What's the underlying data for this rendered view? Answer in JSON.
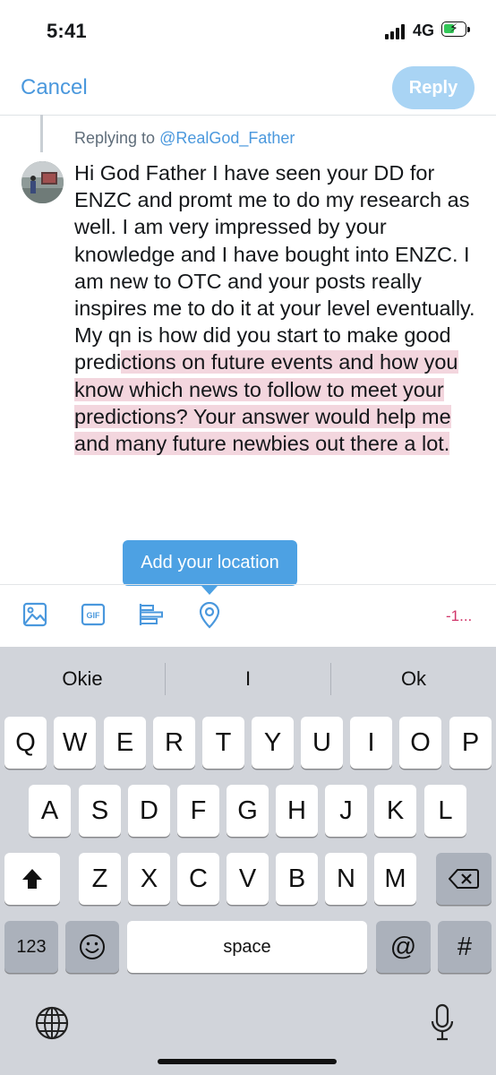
{
  "status_bar": {
    "time": "5:41",
    "network": "4G"
  },
  "header": {
    "cancel_label": "Cancel",
    "reply_label": "Reply"
  },
  "reply_context": {
    "prefix": "Replying to ",
    "handle": "@RealGod_Father"
  },
  "compose": {
    "text_plain": "Hi God Father I have seen your DD for ENZC and promt me to do my research as well. I am very impressed by your knowledge and I have bought into ENZC. I am new to OTC and your posts really inspires me to do it at your level eventually. My qn is how did you start to make good predi",
    "text_highlighted": "ctions on future events and how you know which news to follow to meet your predictions? Your answer would help me and many future newbies out there a lot."
  },
  "tooltip": {
    "text": "Add your location"
  },
  "toolbar": {
    "icons": [
      "image-icon",
      "gif-icon",
      "poll-icon",
      "location-icon"
    ],
    "gif_label": "GIF",
    "char_count": "-1..."
  },
  "colors": {
    "accent": "#4a98dd",
    "reply_disabled": "#a9d4f4",
    "highlight": "#f3d6de",
    "over_limit": "#d0366a"
  },
  "keyboard": {
    "suggestions": [
      "Okie",
      "I",
      "Ok"
    ],
    "row1": [
      "Q",
      "W",
      "E",
      "R",
      "T",
      "Y",
      "U",
      "I",
      "O",
      "P"
    ],
    "row2": [
      "A",
      "S",
      "D",
      "F",
      "G",
      "H",
      "J",
      "K",
      "L"
    ],
    "row3": [
      "Z",
      "X",
      "C",
      "V",
      "B",
      "N",
      "M"
    ],
    "numbers_label": "123",
    "space_label": "space",
    "at_label": "@",
    "hash_label": "#"
  }
}
